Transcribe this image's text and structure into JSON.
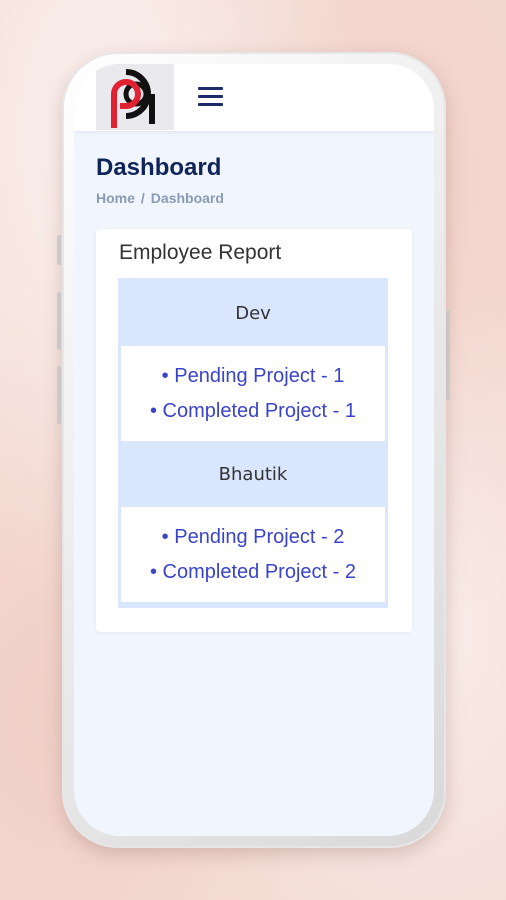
{
  "header": {
    "logo_alt": "Pa",
    "menu_icon": "hamburger-menu-icon"
  },
  "page": {
    "title": "Dashboard",
    "breadcrumb": {
      "home": "Home",
      "separator": "/",
      "current": "Dashboard"
    }
  },
  "report": {
    "title": "Employee Report",
    "employees": [
      {
        "name": "Dev",
        "pending": "• Pending Project - 1",
        "completed": "• Completed Project - 1"
      },
      {
        "name": "Bhautik",
        "pending": "• Pending Project - 2",
        "completed": "• Completed Project - 2"
      }
    ]
  },
  "colors": {
    "brand_red": "#e02233",
    "brand_dark": "#111111",
    "title_navy": "#0f2458",
    "link_blue": "#3a44c8",
    "table_header_bg": "#dae6fe"
  }
}
